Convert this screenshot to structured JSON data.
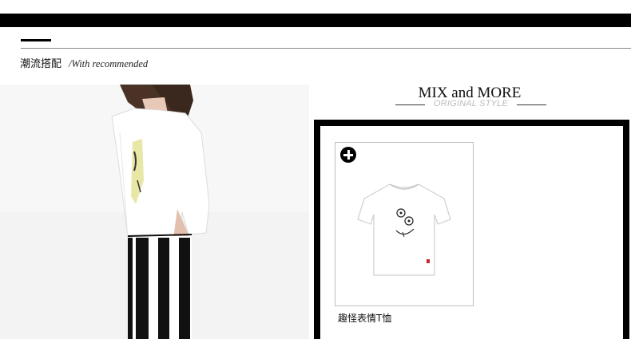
{
  "section": {
    "title_cn": "潮流搭配",
    "title_en": "/With recommended"
  },
  "model_image": {
    "icon": "model-photo"
  },
  "mix": {
    "title": "MIX and MORE",
    "subtitle": "ORIGINAL STYLE"
  },
  "product": {
    "add_icon": "plus-circle-icon",
    "image_icon": "tshirt-photo",
    "name": "趣怪表情T恤"
  },
  "colors": {
    "bar": "#000000",
    "rule": "#888888",
    "subtitle": "#bbbbbb",
    "card_border": "#bdbdbd"
  }
}
